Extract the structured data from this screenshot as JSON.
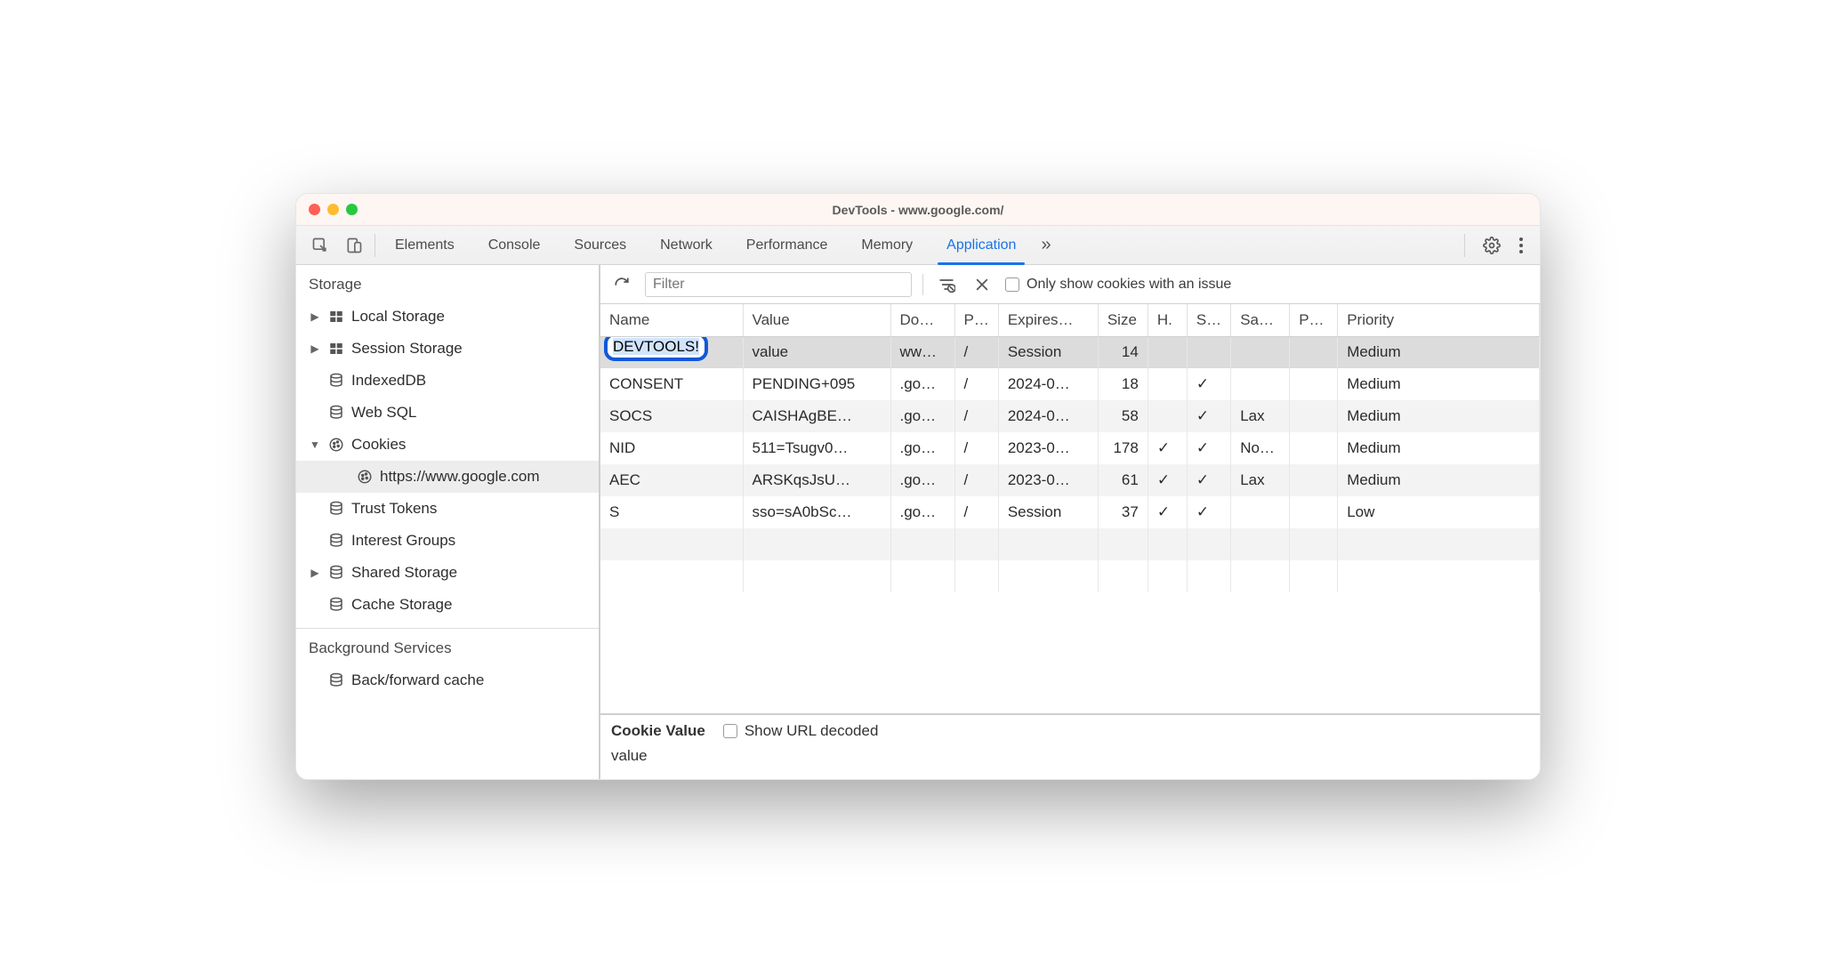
{
  "window": {
    "title": "DevTools - www.google.com/"
  },
  "tabs": {
    "items": [
      "Elements",
      "Console",
      "Sources",
      "Network",
      "Performance",
      "Memory",
      "Application"
    ],
    "activeIndex": 6,
    "overflowGlyph": "»"
  },
  "sidebar": {
    "sections": {
      "storage": {
        "title": "Storage",
        "items": [
          {
            "label": "Local Storage",
            "expandable": true,
            "expanded": false,
            "icon": "grid"
          },
          {
            "label": "Session Storage",
            "expandable": true,
            "expanded": false,
            "icon": "grid"
          },
          {
            "label": "IndexedDB",
            "expandable": false,
            "icon": "db"
          },
          {
            "label": "Web SQL",
            "expandable": false,
            "icon": "db"
          },
          {
            "label": "Cookies",
            "expandable": true,
            "expanded": true,
            "icon": "cookie",
            "children": [
              {
                "label": "https://www.google.com",
                "icon": "cookie",
                "selected": true
              }
            ]
          },
          {
            "label": "Trust Tokens",
            "expandable": false,
            "icon": "db"
          },
          {
            "label": "Interest Groups",
            "expandable": false,
            "icon": "db"
          },
          {
            "label": "Shared Storage",
            "expandable": true,
            "expanded": false,
            "icon": "db"
          },
          {
            "label": "Cache Storage",
            "expandable": false,
            "icon": "db"
          }
        ]
      },
      "background": {
        "title": "Background Services",
        "items": [
          {
            "label": "Back/forward cache",
            "icon": "db"
          }
        ]
      }
    }
  },
  "toolbar": {
    "filter_placeholder": "Filter",
    "only_issue_label": "Only show cookies with an issue"
  },
  "table": {
    "columns": [
      "Name",
      "Value",
      "Do…",
      "P…",
      "Expires…",
      "Size",
      "H.",
      "S…",
      "Sa…",
      "P…",
      "Priority"
    ],
    "rows": [
      {
        "name": "DEVTOOLS!",
        "value": "value",
        "domain": "ww…",
        "path": "/",
        "expires": "Session",
        "size": "14",
        "http": "",
        "secure": "",
        "samesite": "",
        "partition": "",
        "priority": "Medium",
        "selected": true,
        "editing": true
      },
      {
        "name": "CONSENT",
        "value": "PENDING+095",
        "domain": ".go…",
        "path": "/",
        "expires": "2024-0…",
        "size": "18",
        "http": "",
        "secure": "✓",
        "samesite": "",
        "partition": "",
        "priority": "Medium"
      },
      {
        "name": "SOCS",
        "value": "CAISHAgBE…",
        "domain": ".go…",
        "path": "/",
        "expires": "2024-0…",
        "size": "58",
        "http": "",
        "secure": "✓",
        "samesite": "Lax",
        "partition": "",
        "priority": "Medium"
      },
      {
        "name": "NID",
        "value": "511=Tsugv0…",
        "domain": ".go…",
        "path": "/",
        "expires": "2023-0…",
        "size": "178",
        "http": "✓",
        "secure": "✓",
        "samesite": "No…",
        "partition": "",
        "priority": "Medium"
      },
      {
        "name": "AEC",
        "value": "ARSKqsJsU…",
        "domain": ".go…",
        "path": "/",
        "expires": "2023-0…",
        "size": "61",
        "http": "✓",
        "secure": "✓",
        "samesite": "Lax",
        "partition": "",
        "priority": "Medium"
      },
      {
        "name": "S",
        "value": "sso=sA0bSc…",
        "domain": ".go…",
        "path": "/",
        "expires": "Session",
        "size": "37",
        "http": "✓",
        "secure": "✓",
        "samesite": "",
        "partition": "",
        "priority": "Low"
      }
    ]
  },
  "details": {
    "heading": "Cookie Value",
    "decoded_label": "Show URL decoded",
    "value": "value"
  },
  "glyphs": {
    "check": "✓",
    "arrow_right": "▶",
    "arrow_down": "▼"
  }
}
